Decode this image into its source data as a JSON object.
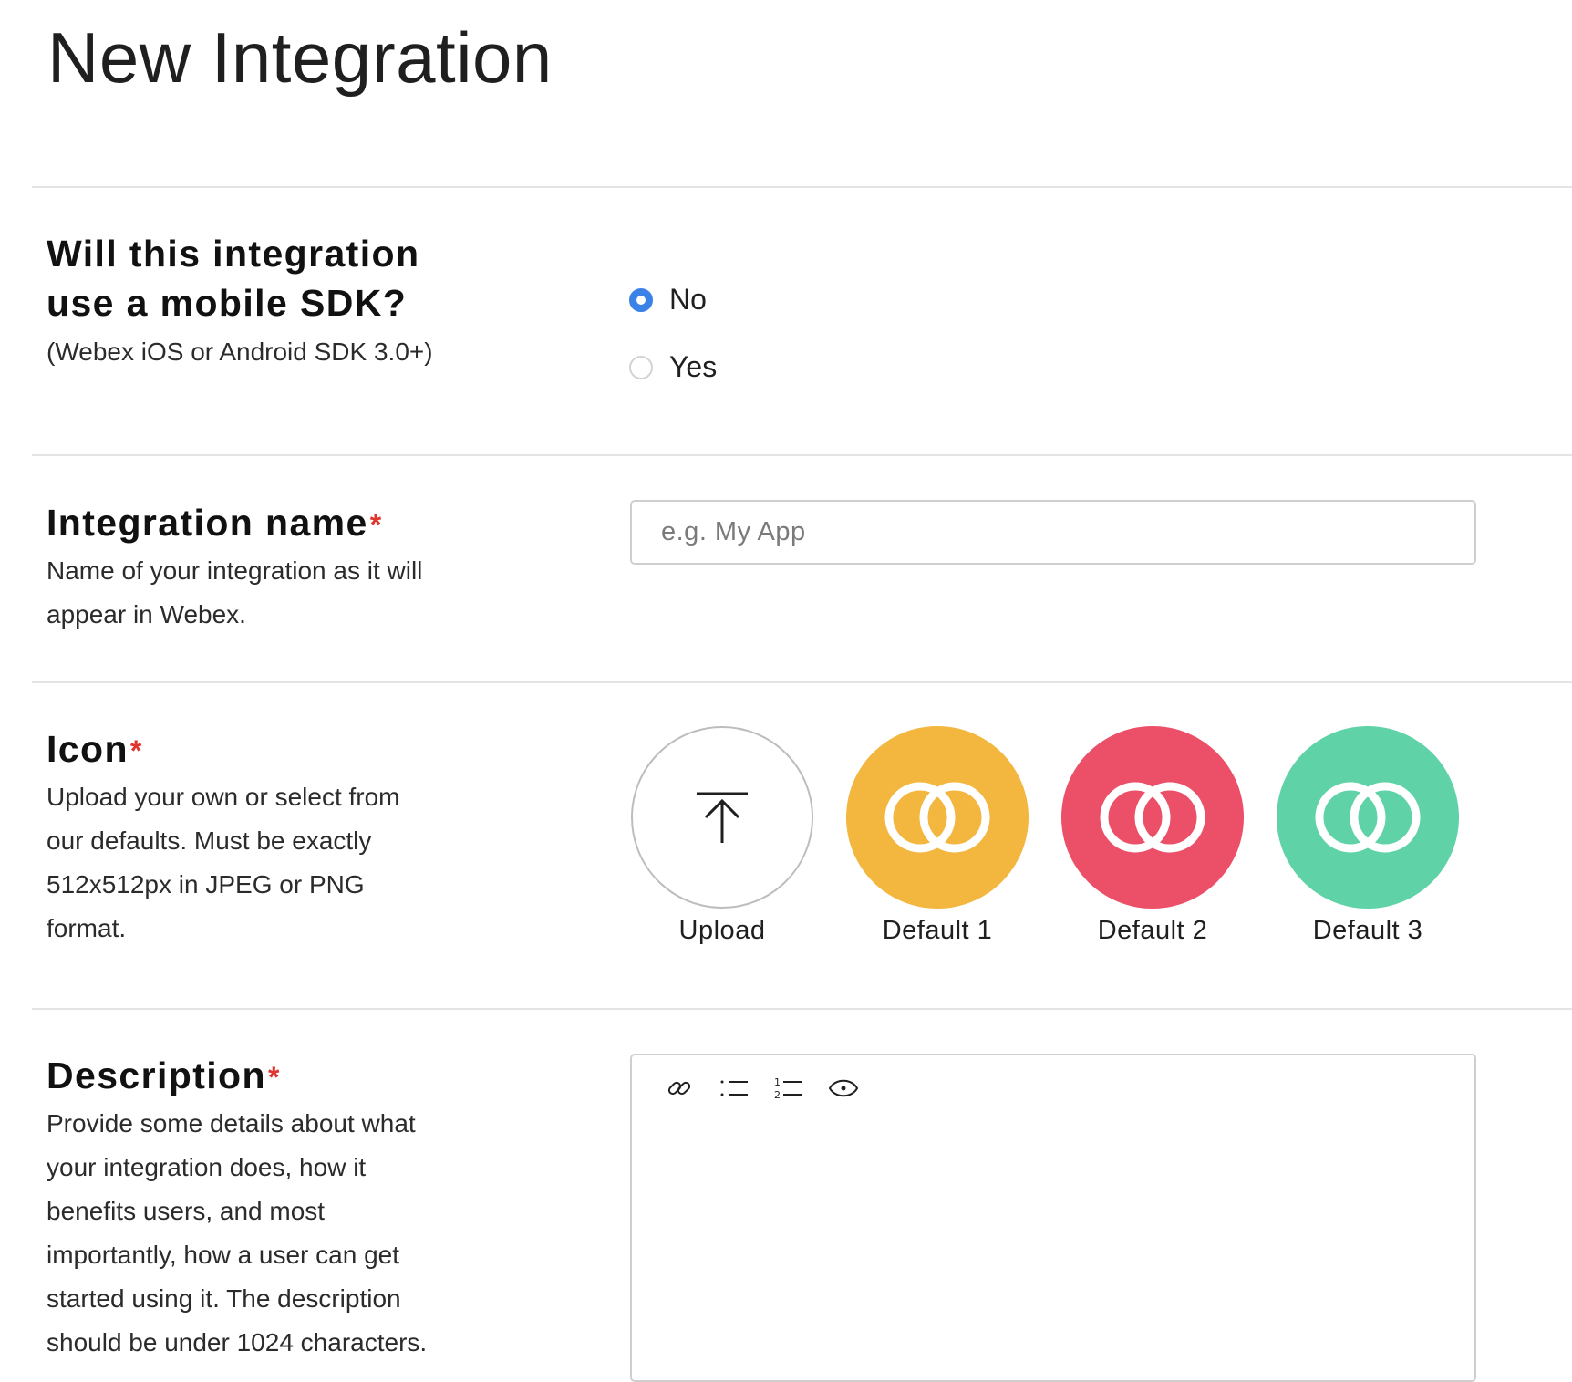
{
  "page": {
    "title": "New Integration"
  },
  "mobile_sdk": {
    "heading_line1": "Will this integration",
    "heading_line2": "use a mobile SDK?",
    "subtext": "(Webex iOS or Android SDK 3.0+)",
    "options": [
      {
        "label": "No",
        "selected": true
      },
      {
        "label": "Yes",
        "selected": false
      }
    ]
  },
  "integration_name": {
    "heading": "Integration name",
    "required_mark": "*",
    "description_line1": "Name of your integration as it will",
    "description_line2": "appear in Webex.",
    "input_value": "",
    "input_placeholder": "e.g. My App"
  },
  "icon": {
    "heading": "Icon",
    "required_mark": "*",
    "description_lines": [
      "Upload your own or select from",
      "our defaults. Must be exactly",
      "512x512px in JPEG or PNG",
      "format."
    ],
    "choices": [
      {
        "label": "Upload",
        "icon": "upload-arrow-icon",
        "color": "#ffffff"
      },
      {
        "label": "Default 1",
        "icon": "linked-rings-icon",
        "color": "#f3b63f"
      },
      {
        "label": "Default 2",
        "icon": "linked-rings-icon",
        "color": "#ec4f68"
      },
      {
        "label": "Default 3",
        "icon": "linked-rings-icon",
        "color": "#5fd3a7"
      }
    ]
  },
  "description": {
    "heading": "Description",
    "required_mark": "*",
    "description_lines": [
      "Provide some details about what",
      "your integration does, how it",
      "benefits users, and most",
      "importantly, how a user can get",
      "started using it. The description",
      "should be under 1024 characters."
    ],
    "toolbar": [
      "link-icon",
      "bulleted-list-icon",
      "numbered-list-icon",
      "preview-eye-icon"
    ],
    "editor_value": ""
  },
  "colors": {
    "accent": "#3b82e8",
    "required": "#e0342f",
    "default_1": "#f3b63f",
    "default_2": "#ec4f68",
    "default_3": "#5fd3a7"
  }
}
